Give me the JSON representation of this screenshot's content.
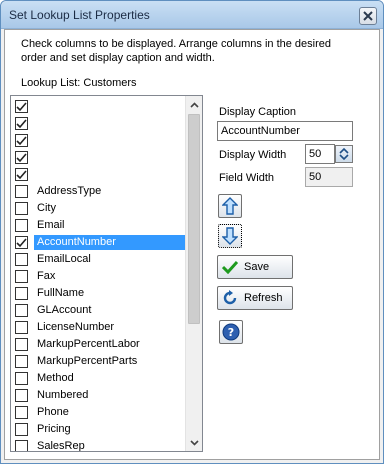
{
  "window": {
    "title": "Set Lookup List Properties"
  },
  "instructions": "Check columns to be displayed.  Arrange columns in the desired order and set display caption and width.",
  "lookup_list": {
    "label": "Lookup List: Customers"
  },
  "columns": [
    {
      "label": "",
      "checked": true
    },
    {
      "label": "",
      "checked": true
    },
    {
      "label": "",
      "checked": true
    },
    {
      "label": "",
      "checked": true
    },
    {
      "label": "",
      "checked": true
    },
    {
      "label": "AddressType",
      "checked": false
    },
    {
      "label": "City",
      "checked": false
    },
    {
      "label": "Email",
      "checked": false
    },
    {
      "label": "AccountNumber",
      "checked": true,
      "selected": true
    },
    {
      "label": "EmailLocal",
      "checked": false
    },
    {
      "label": "Fax",
      "checked": false
    },
    {
      "label": "FullName",
      "checked": false
    },
    {
      "label": "GLAccount",
      "checked": false
    },
    {
      "label": "LicenseNumber",
      "checked": false
    },
    {
      "label": "MarkupPercentLabor",
      "checked": false
    },
    {
      "label": "MarkupPercentParts",
      "checked": false
    },
    {
      "label": "Method",
      "checked": false
    },
    {
      "label": "Numbered",
      "checked": false
    },
    {
      "label": "Phone",
      "checked": false
    },
    {
      "label": "Pricing",
      "checked": false
    },
    {
      "label": "SalesRep",
      "checked": false
    }
  ],
  "properties": {
    "display_caption_label": "Display Caption",
    "display_caption_value": "AccountNumber",
    "display_width_label": "Display Width",
    "display_width_value": "50",
    "field_width_label": "Field Width",
    "field_width_value": "50"
  },
  "buttons": {
    "save_label": "Save",
    "refresh_label": "Refresh"
  },
  "colors": {
    "selection": "#3399ff",
    "titlebar": "#b9d4ef"
  }
}
